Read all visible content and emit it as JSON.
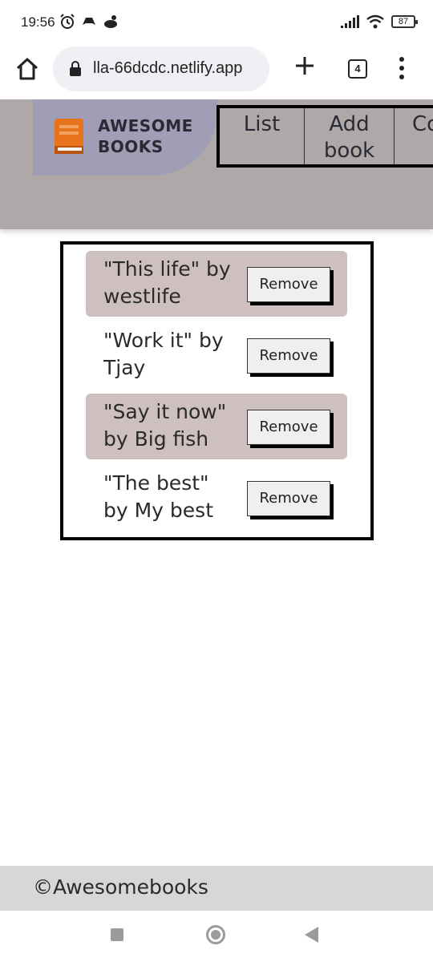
{
  "status_bar": {
    "time": "19:56",
    "battery": "87",
    "left_icons": [
      "alarm-icon",
      "gamepad-icon",
      "notification-icon"
    ],
    "right_icons": [
      "signal-icon",
      "wifi-icon",
      "battery-icon"
    ]
  },
  "browser": {
    "url": "lla-66dcdc.netlify.app",
    "tab_count": "4"
  },
  "header": {
    "logo_line1": "AWESOME",
    "logo_line2": "BOOKS",
    "nav": {
      "list": "List",
      "add_line1": "Add",
      "add_line2": "book",
      "contact": "Co"
    }
  },
  "books": [
    {
      "title_line1": "\"This life\" by",
      "title_line2": "westlife",
      "remove_label": "Remove"
    },
    {
      "title_line1": "\"Work it\" by",
      "title_line2": "Tjay",
      "remove_label": "Remove"
    },
    {
      "title_line1": "\"Say it now\"",
      "title_line2": "by Big fish",
      "remove_label": "Remove"
    },
    {
      "title_line1": "\"The best\"",
      "title_line2": "by My best",
      "remove_label": "Remove"
    }
  ],
  "footer": {
    "text": "©Awesomebooks"
  },
  "colors": {
    "header_bg": "#aea8a8",
    "logo_blob": "#a09eb4",
    "row_shade": "#cdc0bf",
    "logo_book": "#e8731c",
    "footer_bg": "#d9d6d6"
  }
}
